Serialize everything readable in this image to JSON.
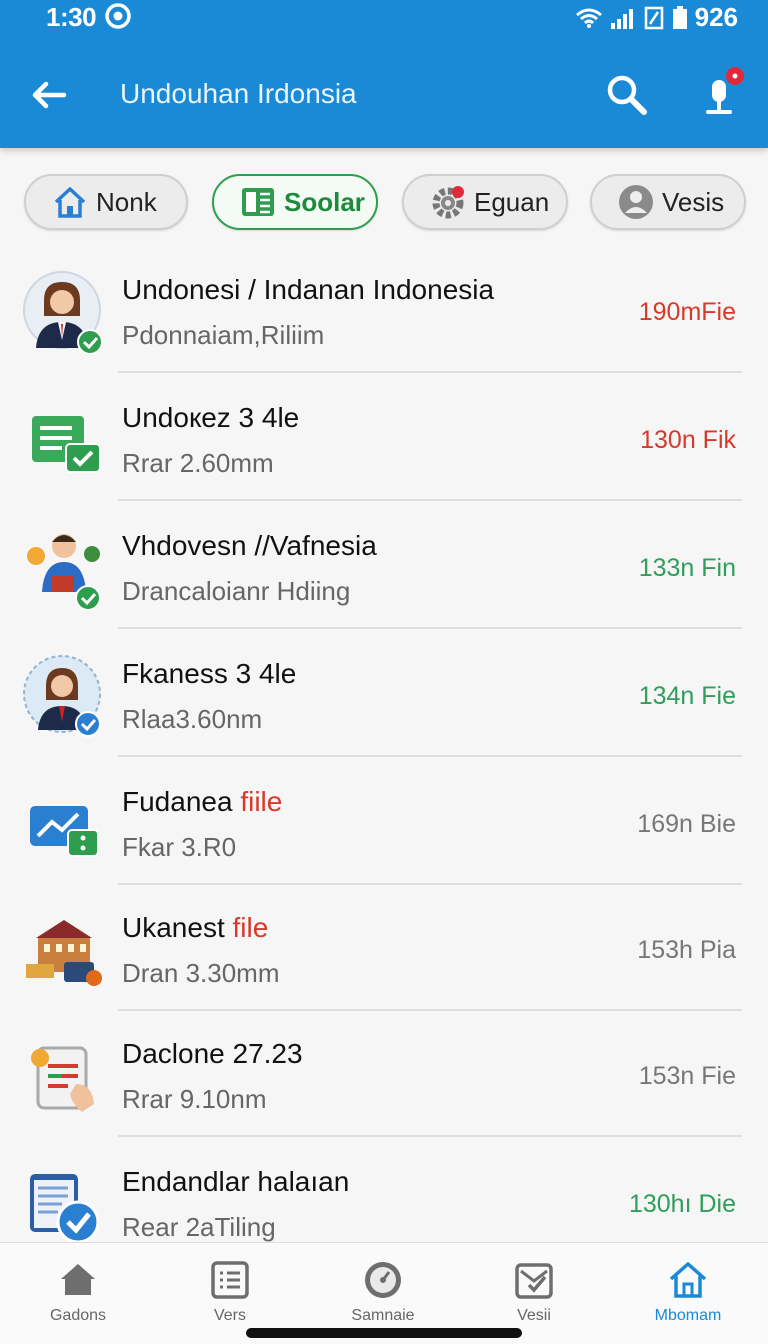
{
  "status_bar": {
    "time": "1:30",
    "battery_text": "926"
  },
  "header": {
    "title": "Undouhan Irdonsia",
    "search_icon": "search-icon",
    "mic_icon": "microphone-icon",
    "accent": "#1a8ad6"
  },
  "chips": [
    {
      "label": "Nonk",
      "icon": "home-icon"
    },
    {
      "label": "Soolar",
      "icon": "spreadsheet-icon",
      "active": true
    },
    {
      "label": "Eguan",
      "icon": "gear-icon"
    },
    {
      "label": "Vesis",
      "icon": "person-icon"
    }
  ],
  "rows": [
    {
      "title": "Undonesi / Indanan Indonesia",
      "title_red": "",
      "subtitle": "Pdonnaiam,Riliim",
      "meta": "190mFie",
      "meta_color": "#d63a2a",
      "icon": "woman-avatar-icon"
    },
    {
      "title": "Undокez 3 4le",
      "title_red": "",
      "subtitle": "Rrar 2.60mm",
      "meta": "130n Fik",
      "meta_color": "#d63a2a",
      "icon": "checked-document-icon"
    },
    {
      "title": "Vhdovesn //Vafnesia",
      "title_red": "",
      "subtitle": "Drancaloianr Hdiing",
      "meta": "133n Fin",
      "meta_color": "#2e9e5a",
      "icon": "man-avatar-icon"
    },
    {
      "title": "Fkaness 3 4le",
      "title_red": "",
      "subtitle": "Rlaa3.60nm",
      "meta": "134n Fie",
      "meta_color": "#2e9e5a",
      "icon": "woman-avatar-icon"
    },
    {
      "title": "Fudanea ",
      "title_red": "fiile",
      "subtitle": "Fkar 3.R0",
      "meta": "169n Bie",
      "meta_color": "#777777",
      "icon": "chart-card-icon"
    },
    {
      "title": "Ukanest ",
      "title_red": "file",
      "subtitle": "Dran 3.30mm",
      "meta": "153h Pia",
      "meta_color": "#777777",
      "icon": "building-icon"
    },
    {
      "title": "Daclone 27.23",
      "title_red": "",
      "subtitle": "Rrar 9.10nm",
      "meta": "153n Fie",
      "meta_color": "#777777",
      "icon": "tablet-icon"
    },
    {
      "title": "Endandlar halaıan",
      "title_red": "",
      "subtitle": "Rear 2aTiling",
      "meta": "130hı Die",
      "meta_color": "#2e9e5a",
      "icon": "checked-list-icon"
    }
  ],
  "bottom_nav": [
    {
      "label": "Gadons",
      "icon": "home-icon"
    },
    {
      "label": "Vers",
      "icon": "list-icon"
    },
    {
      "label": "Samnaie",
      "icon": "compass-icon"
    },
    {
      "label": "Vesii",
      "icon": "mail-check-icon"
    },
    {
      "label": "Mbomam",
      "icon": "home-outline-icon",
      "active": true
    }
  ]
}
